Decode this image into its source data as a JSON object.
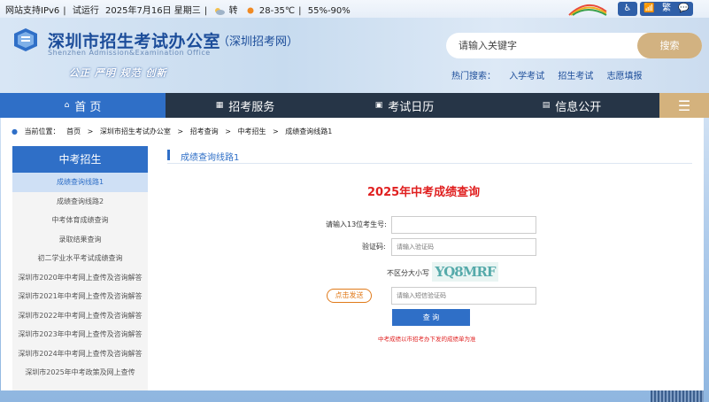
{
  "topbar": {
    "ipv6": "网站支持IPv6",
    "trial": "试运行",
    "date": "2025年7月16日 星期三",
    "weather": "转",
    "temp": "28-35℃",
    "humidity": "55%-90%",
    "accessibility": [
      "♿",
      "📶",
      "繁"
    ]
  },
  "header": {
    "title": "深圳市招生考试办公室",
    "subtitle": "（深圳招考网）",
    "english": "Shenzhen Admission&Examination Office",
    "slogan": "公正  严明  规范  创新"
  },
  "search": {
    "placeholder": "请输入关键字",
    "button": "搜索",
    "hot_label": "热门搜索：",
    "hot_items": [
      "入学考试",
      "招生考试",
      "志愿填报"
    ]
  },
  "nav": {
    "items": [
      "首 页",
      "招考服务",
      "考试日历",
      "信息公开"
    ],
    "menu": "☰"
  },
  "breadcrumb": {
    "label": "当前位置：",
    "items": [
      "首页",
      ">",
      "深圳市招生考试办公室",
      ">",
      "招考查询",
      ">",
      "中考招生",
      ">",
      "成绩查询线路1"
    ]
  },
  "sidebar": {
    "title": "中考招生",
    "items": [
      "成绩查询线路1",
      "成绩查询线路2",
      "中考体育成绩查询",
      "录取结果查询",
      "初二学业水平考试成绩查询",
      "深圳市2020年中考网上查传及咨询解答",
      "深圳市2021年中考网上查传及咨询解答",
      "深圳市2022年中考网上查传及咨询解答",
      "深圳市2023年中考网上查传及咨询解答",
      "深圳市2024年中考网上查传及咨询解答",
      "深圳市2025年中考政策及网上查传"
    ]
  },
  "section": {
    "title": "成绩查询线路1"
  },
  "form": {
    "heading": "2025年中考成绩查询",
    "id_label": "请输入13位考生号:",
    "captcha_label": "验证码:",
    "captcha_placeholder": "请输入验证码",
    "case_note": "不区分大小写",
    "captcha_text": "YQ8MRF",
    "sms_button": "点击发送",
    "sms_placeholder": "请输入短信验证码",
    "query_button": "查 询",
    "note": "中考成绩以市招考办下发的成绩单为准"
  },
  "colors": {
    "primary": "#2f6fc7",
    "nav_dark": "#263547",
    "accent_gold": "#d4b27d",
    "red": "#e02020",
    "orange": "#e07a1a"
  }
}
